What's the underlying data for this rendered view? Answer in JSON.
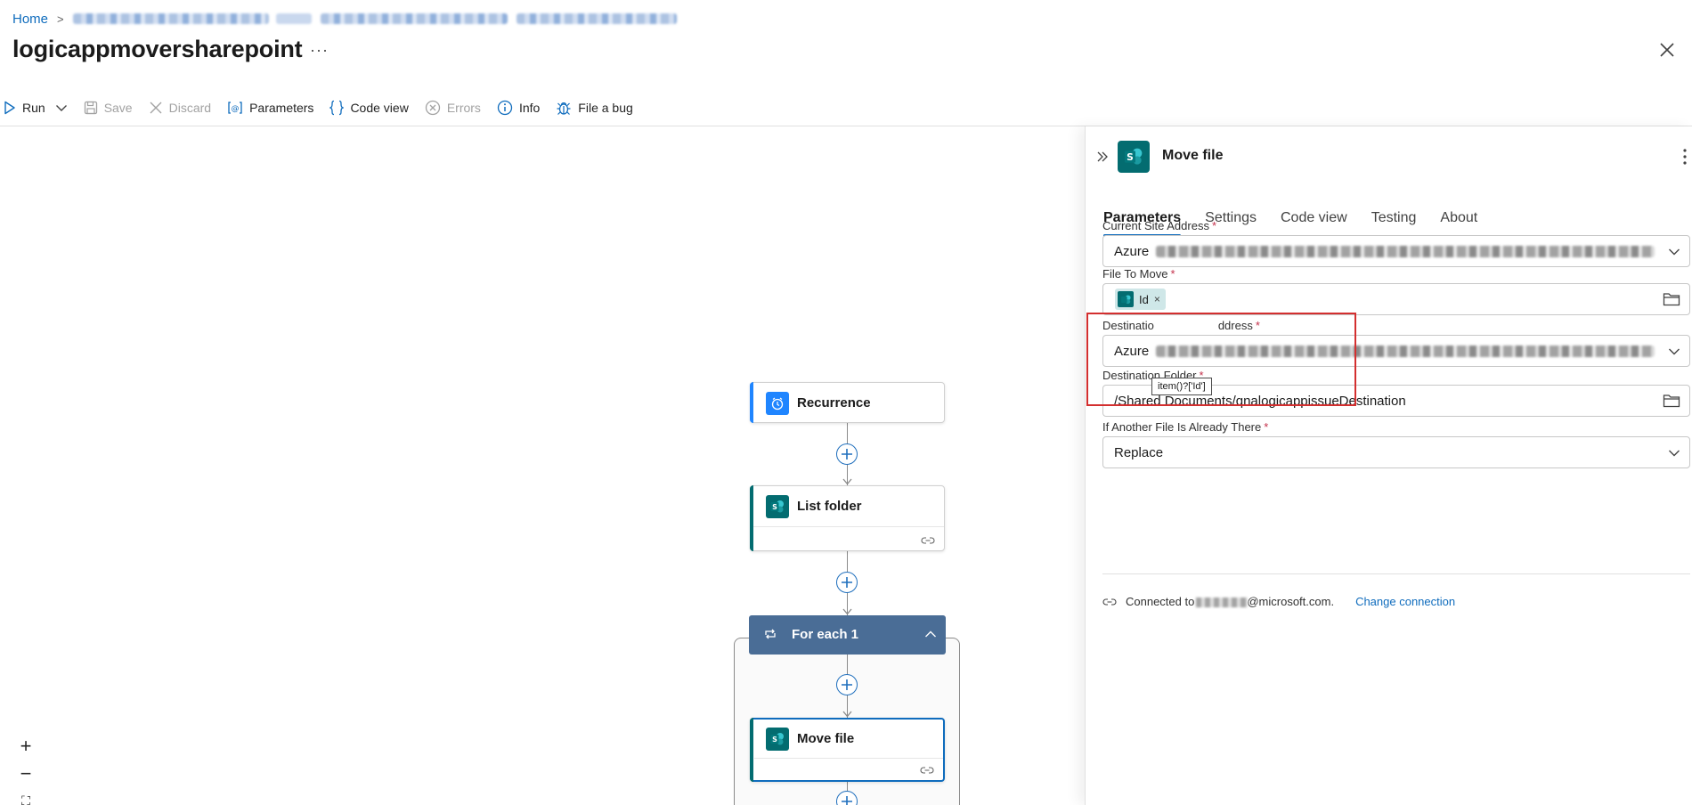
{
  "breadcrumb": {
    "home": "Home",
    "separator": ">"
  },
  "page": {
    "title": "logicappmoversharepoint",
    "more": "···"
  },
  "toolbar": {
    "run": "Run",
    "save": "Save",
    "discard": "Discard",
    "parameters": "Parameters",
    "code_view": "Code view",
    "errors": "Errors",
    "info": "Info",
    "file_bug": "File a bug"
  },
  "workflow": {
    "nodes": [
      {
        "title": "Recurrence",
        "icon": "clock-icon",
        "color": "#1f85ff"
      },
      {
        "title": "List folder",
        "icon": "sharepoint-icon",
        "color": "#036c70"
      },
      {
        "title": "For each 1",
        "icon": "loop-icon",
        "color": "#4a6d96"
      },
      {
        "title": "Move file",
        "icon": "sharepoint-icon",
        "color": "#036c70"
      }
    ]
  },
  "zoom": {
    "in": "+",
    "out": "−",
    "fit": "⛶"
  },
  "panel": {
    "title": "Move file",
    "tabs": [
      "Parameters",
      "Settings",
      "Code view",
      "Testing",
      "About"
    ],
    "active_tab": "Parameters",
    "fields": {
      "current_site": {
        "label": "Current Site Address",
        "required": "*",
        "value": "Azure"
      },
      "file_to_move": {
        "label": "File To Move",
        "required": "*",
        "token": "Id",
        "token_close": "×"
      },
      "destination_site": {
        "label": "Destination Site Address",
        "label_visible_start": "Destinatio",
        "label_visible_end": "ddress",
        "required": "*",
        "value": "Azure"
      },
      "destination_folder": {
        "label": "Destination Folder",
        "required": "*",
        "value": "/Shared Documents/qnalogicappissueDestination"
      },
      "if_exists": {
        "label": "If Another File Is Already There",
        "required": "*",
        "value": "Replace"
      }
    },
    "tooltip": "item()?['Id']",
    "connection": {
      "prefix": "Connected to",
      "suffix": "@microsoft.com.",
      "change": "Change connection"
    }
  },
  "colors": {
    "accent": "#0f6cbd",
    "sharepoint": "#036c70",
    "highlight": "#d32f2f"
  }
}
